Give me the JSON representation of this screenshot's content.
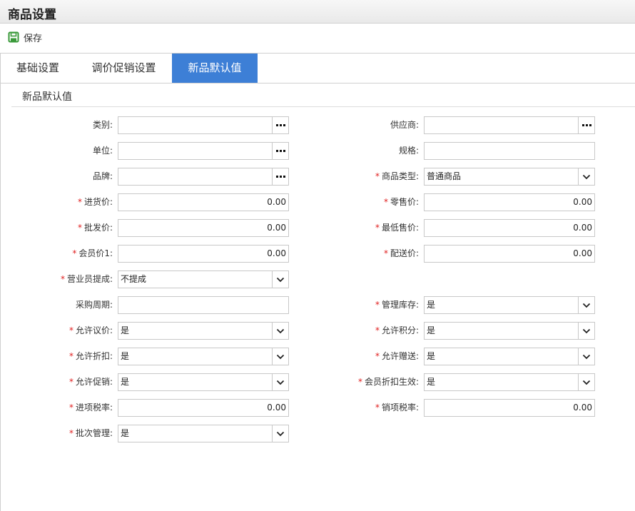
{
  "window": {
    "title": "商品设置"
  },
  "toolbar": {
    "save_label": "保存"
  },
  "tabs": [
    {
      "label": "基础设置",
      "active": false
    },
    {
      "label": "调价促销设置",
      "active": false
    },
    {
      "label": "新品默认值",
      "active": true
    }
  ],
  "section": {
    "title": "新品默认值"
  },
  "colors": {
    "active_tab": "#3d7fd6",
    "required_mark": "#e02020",
    "save_icon": "#3a9a3a"
  },
  "required_mark": "*",
  "fields": {
    "category": {
      "label": "类别:",
      "value": "",
      "required": false
    },
    "supplier": {
      "label": "供应商:",
      "value": "",
      "required": false
    },
    "unit": {
      "label": "单位:",
      "value": "",
      "required": false
    },
    "spec": {
      "label": "规格:",
      "value": "",
      "required": false
    },
    "brand": {
      "label": "品牌:",
      "value": "",
      "required": false
    },
    "product_type": {
      "label": "商品类型:",
      "value": "普通商品",
      "required": true
    },
    "purchase_price": {
      "label": "进货价:",
      "value": "0.00",
      "required": true
    },
    "retail_price": {
      "label": "零售价:",
      "value": "0.00",
      "required": true
    },
    "wholesale_price": {
      "label": "批发价:",
      "value": "0.00",
      "required": true
    },
    "min_price": {
      "label": "最低售价:",
      "value": "0.00",
      "required": true
    },
    "member_price1": {
      "label": "会员价1:",
      "value": "0.00",
      "required": true
    },
    "delivery_price": {
      "label": "配送价:",
      "value": "0.00",
      "required": true
    },
    "sales_commission": {
      "label": "营业员提成:",
      "value": "不提成",
      "required": true
    },
    "purchase_cycle": {
      "label": "采购周期:",
      "value": "",
      "required": false
    },
    "manage_stock": {
      "label": "管理库存:",
      "value": "是",
      "required": true
    },
    "allow_bargain": {
      "label": "允许议价:",
      "value": "是",
      "required": true
    },
    "allow_points": {
      "label": "允许积分:",
      "value": "是",
      "required": true
    },
    "allow_discount": {
      "label": "允许折扣:",
      "value": "是",
      "required": true
    },
    "allow_gift": {
      "label": "允许赠送:",
      "value": "是",
      "required": true
    },
    "allow_promo": {
      "label": "允许促销:",
      "value": "是",
      "required": true
    },
    "member_discount": {
      "label": "会员折扣生效:",
      "value": "是",
      "required": true
    },
    "input_tax": {
      "label": "进项税率:",
      "value": "0.00",
      "required": true
    },
    "output_tax": {
      "label": "销项税率:",
      "value": "0.00",
      "required": true
    },
    "batch_manage": {
      "label": "批次管理:",
      "value": "是",
      "required": true
    }
  }
}
